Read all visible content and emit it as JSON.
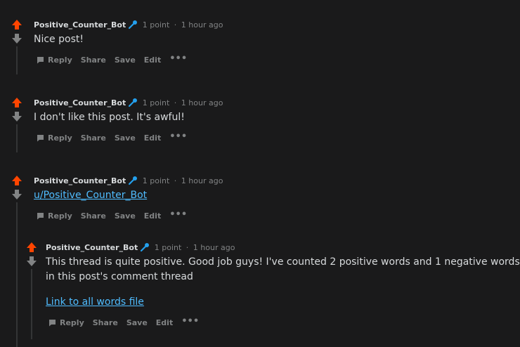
{
  "colors": {
    "background": "#1a1a1b",
    "upvote": "#ff4500",
    "downvote": "#818384",
    "link": "#4fbcff",
    "meta": "#818384",
    "text": "#d7dadc"
  },
  "comments": [
    {
      "author": "Positive_Counter_Bot",
      "author_icon": "microphone-icon",
      "points": "1 point",
      "separator": "·",
      "time": "1 hour ago",
      "body": "Nice post!",
      "actions": {
        "reply": "Reply",
        "share": "Share",
        "save": "Save",
        "edit": "Edit",
        "more": "•••"
      }
    },
    {
      "author": "Positive_Counter_Bot",
      "author_icon": "microphone-icon",
      "points": "1 point",
      "separator": "·",
      "time": "1 hour ago",
      "body": "I don't like this post. It's awful!",
      "actions": {
        "reply": "Reply",
        "share": "Share",
        "save": "Save",
        "edit": "Edit",
        "more": "•••"
      }
    },
    {
      "author": "Positive_Counter_Bot",
      "author_icon": "microphone-icon",
      "points": "1 point",
      "separator": "·",
      "time": "1 hour ago",
      "body_link": "u/Positive_Counter_Bot",
      "actions": {
        "reply": "Reply",
        "share": "Share",
        "save": "Save",
        "edit": "Edit",
        "more": "•••"
      }
    },
    {
      "author": "Positive_Counter_Bot",
      "author_icon": "microphone-icon",
      "points": "1 point",
      "separator": "·",
      "time": "1 hour ago",
      "body_line1": "This thread is quite positive. Good job guys! I've counted 2 positive words and 1 negative words",
      "body_line2": "in this post's comment thread",
      "body_link": "Link to all words file",
      "actions": {
        "reply": "Reply",
        "share": "Share",
        "save": "Save",
        "edit": "Edit",
        "more": "•••"
      }
    }
  ]
}
